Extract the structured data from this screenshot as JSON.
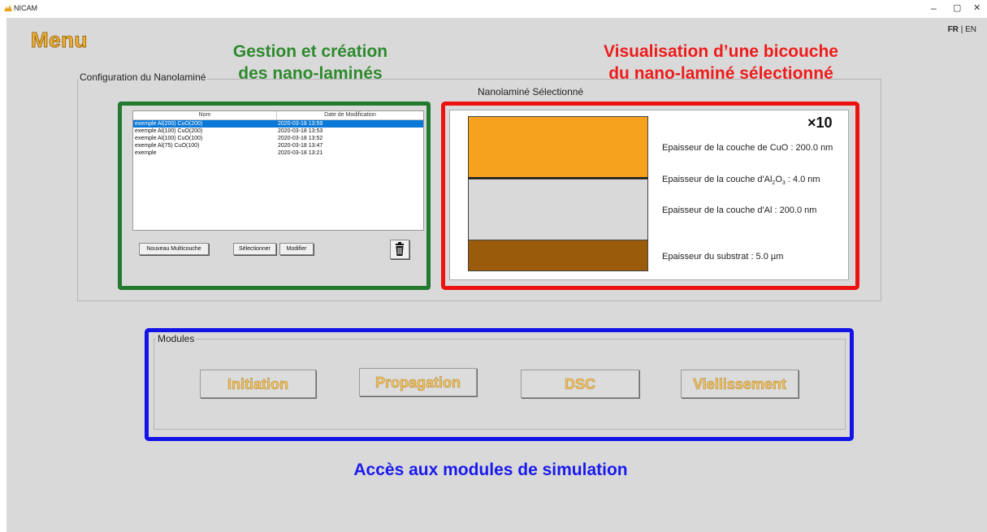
{
  "window": {
    "title": "NICAM",
    "minimize": "–",
    "maximize": "▢",
    "close": "✕"
  },
  "lang": {
    "fr": "FR",
    "sep": "|",
    "en": "EN"
  },
  "menu_title": "Menu",
  "annotations": {
    "green_line1": "Gestion et création",
    "green_line2": "des nano-laminés",
    "red_line1": "Visualisation d’une bicouche",
    "red_line2": "du nano-laminé sélectionné",
    "blue": "Accès aux modules de simulation"
  },
  "config": {
    "group_label": "Configuration du Nanolaminé",
    "selected_label": "Nanolaminé Sélectionné",
    "list": {
      "columns": [
        "Nom",
        "Date de Modification"
      ],
      "rows": [
        {
          "name": "exemple Al(200) CuO(200)",
          "date": "2020-03-18 13:59",
          "selected": true
        },
        {
          "name": "exemple Al(100) CuO(200)",
          "date": "2020-03-18 13:53"
        },
        {
          "name": "exemple Al(100) CuO(100)",
          "date": "2020-03-18 13:52"
        },
        {
          "name": "exemple Al(75) CuO(100)",
          "date": "2020-03-18 13:47"
        },
        {
          "name": "exemple",
          "date": "2020-03-18 13:21"
        }
      ]
    },
    "buttons": {
      "new": "Nouveau Multicouche",
      "select": "Sélectionner",
      "modify": "Modifier",
      "delete_icon": "trash-icon"
    }
  },
  "viz": {
    "multiplier": "×10",
    "cuo": "Epaisseur de la couche de CuO : 200.0 nm",
    "al2o3_prefix": "Epaisseur de la couche d'Al",
    "al2o3_sub2": "2",
    "al2o3_o": "O",
    "al2o3_sub3": "3",
    "al2o3_suffix": " : 4.0 nm",
    "al": "Epaisseur de la couche d'Al : 200.0 nm",
    "substrate": "Epaisseur du substrat : 5.0 µm",
    "colors": {
      "cuo": "#f6a21f",
      "al2o3": "#222222",
      "al": "#d9d9d9",
      "substrate": "#9a5b0b"
    }
  },
  "modules": {
    "group_label": "Modules",
    "buttons": [
      "Initiation",
      "Propagation",
      "DSC",
      "Viellissement"
    ]
  },
  "colors": {
    "green": "#217a2f",
    "red": "#ee1111",
    "blue": "#1313e8",
    "menu": "#f2b33a"
  }
}
